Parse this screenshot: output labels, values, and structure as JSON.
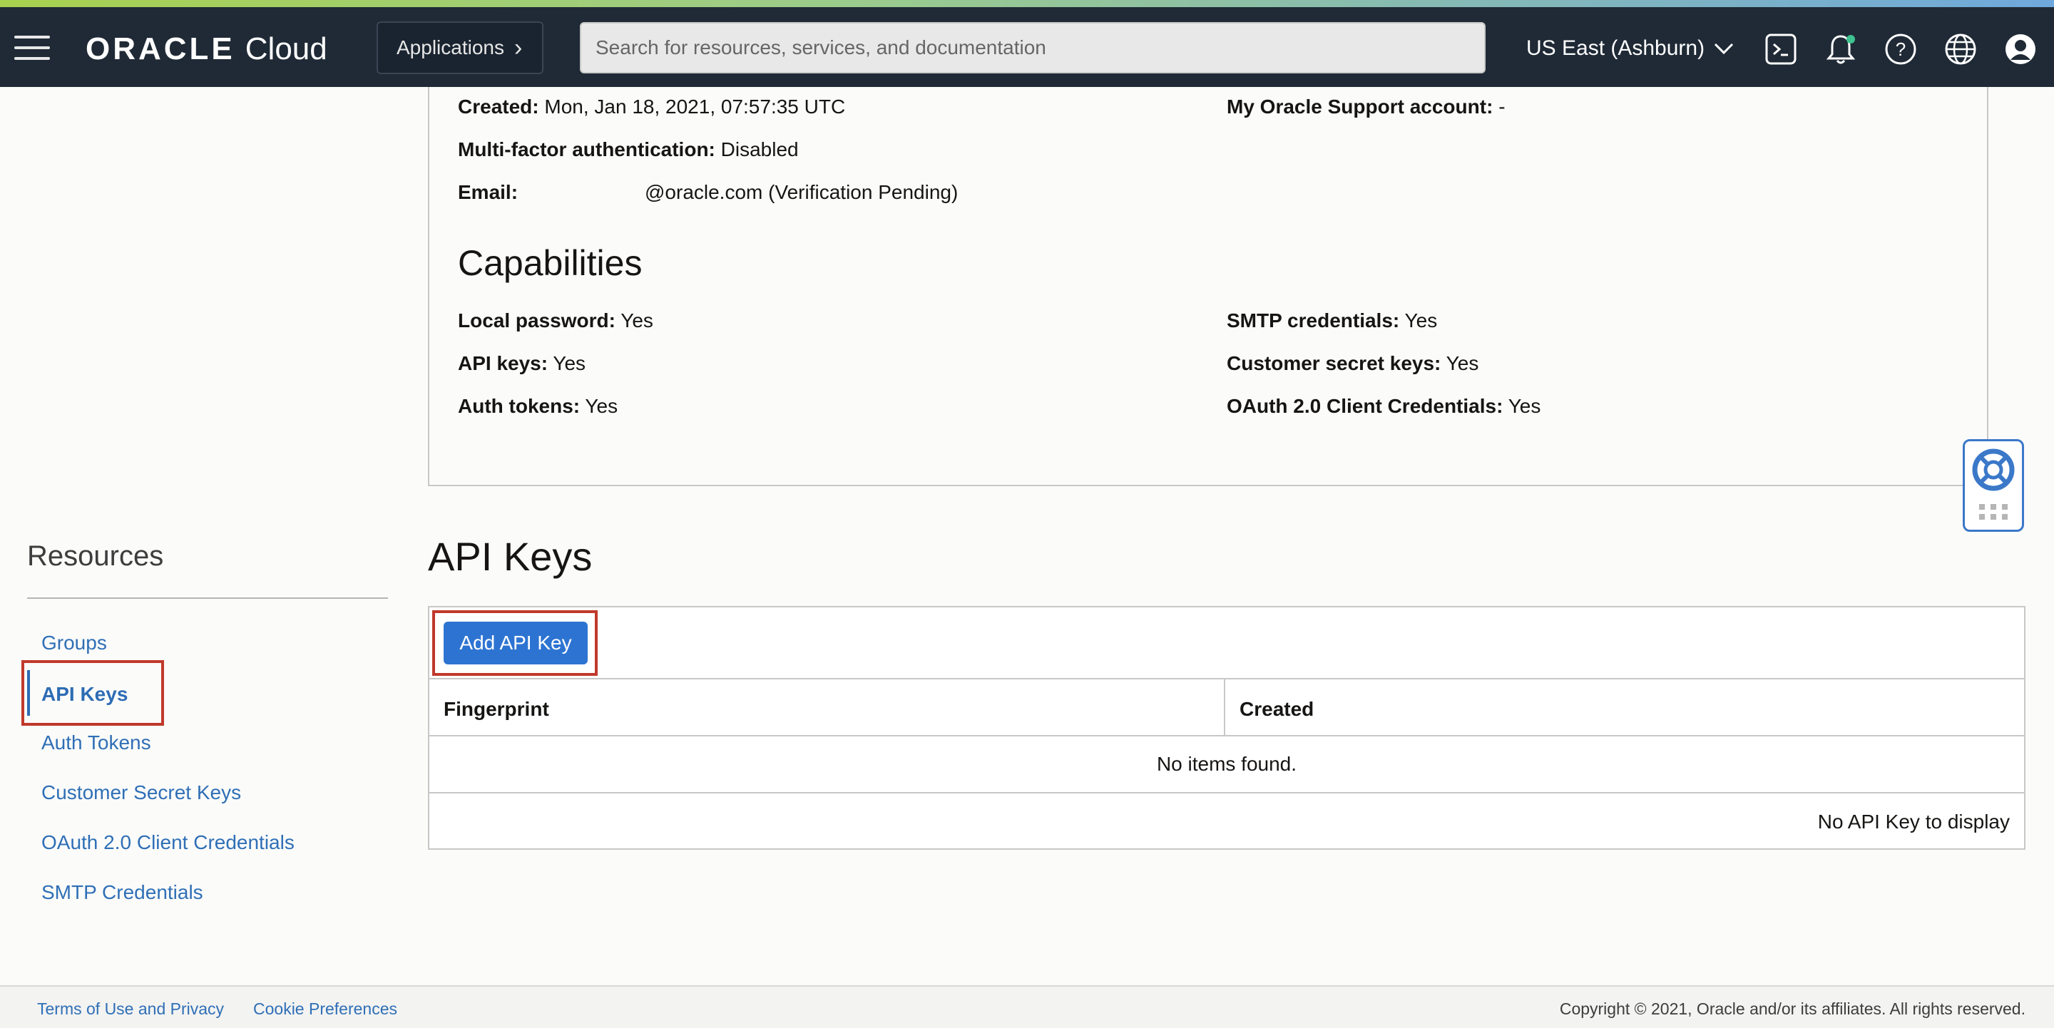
{
  "header": {
    "brand": "ORACLE",
    "product": "Cloud",
    "applications_label": "Applications",
    "search_placeholder": "Search for resources, services, and documentation",
    "region": "US East (Ashburn)",
    "icons": [
      "menu-icon",
      "cloud-shell-icon",
      "notifications-icon",
      "help-icon",
      "language-icon",
      "profile-icon"
    ],
    "accent_colors": [
      "#a8d14f",
      "#6fa8dc"
    ],
    "bar_color": "#1f2a36"
  },
  "user_details": {
    "created_label": "Created:",
    "created_value": "Mon, Jan 18, 2021, 07:57:35 UTC",
    "support_label": "My Oracle Support account:",
    "support_value": "-",
    "mfa_label": "Multi-factor authentication:",
    "mfa_value": "Disabled",
    "email_label": "Email:",
    "email_value": "@oracle.com (Verification Pending)"
  },
  "capabilities": {
    "title": "Capabilities",
    "items": [
      {
        "label": "Local password:",
        "value": "Yes"
      },
      {
        "label": "SMTP credentials:",
        "value": "Yes"
      },
      {
        "label": "API keys:",
        "value": "Yes"
      },
      {
        "label": "Customer secret keys:",
        "value": "Yes"
      },
      {
        "label": "Auth tokens:",
        "value": "Yes"
      },
      {
        "label": "OAuth 2.0 Client Credentials:",
        "value": "Yes"
      }
    ]
  },
  "resources": {
    "title": "Resources",
    "items": [
      {
        "label": "Groups",
        "active": false
      },
      {
        "label": "API Keys",
        "active": true
      },
      {
        "label": "Auth Tokens",
        "active": false
      },
      {
        "label": "Customer Secret Keys",
        "active": false
      },
      {
        "label": "OAuth 2.0 Client Credentials",
        "active": false
      },
      {
        "label": "SMTP Credentials",
        "active": false
      }
    ]
  },
  "api_keys": {
    "title": "API Keys",
    "add_button": "Add API Key",
    "columns": [
      "Fingerprint",
      "Created"
    ],
    "empty_message": "No items found.",
    "footer_message": "No API Key to display",
    "button_color": "#2d74d2"
  },
  "footer": {
    "terms": "Terms of Use and Privacy",
    "cookies": "Cookie Preferences",
    "copyright": "Copyright © 2021, Oracle and/or its affiliates. All rights reserved."
  },
  "highlight_color": "#c0392b"
}
